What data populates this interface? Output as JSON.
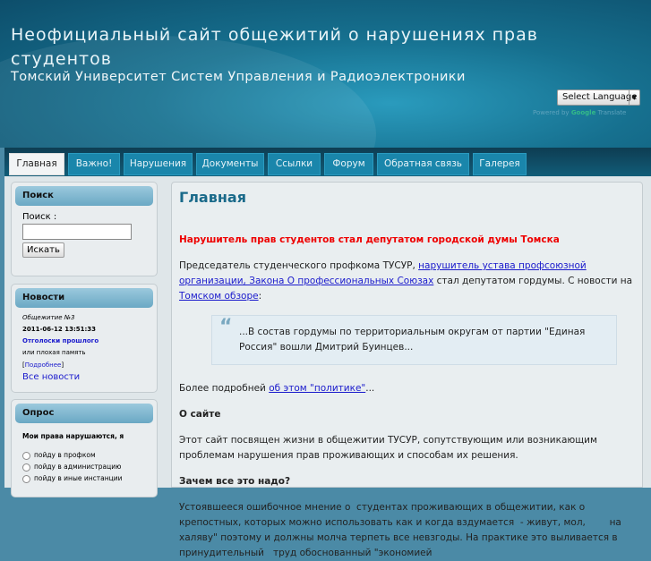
{
  "header": {
    "title": "Неофициальный сайт общежитий о нарушениях прав студентов",
    "subtitle": "Томский Университет Систем Управления и Радиоэлектроники",
    "language_select": "Select Language",
    "powered_by": "Powered by",
    "google": "Google",
    "translate": "Translate"
  },
  "nav": [
    {
      "label": "Главная",
      "active": true
    },
    {
      "label": "Важно!"
    },
    {
      "label": "Нарушения"
    },
    {
      "label": "Документы"
    },
    {
      "label": "Ссылки"
    },
    {
      "label": "Форум"
    },
    {
      "label": "Обратная связь"
    },
    {
      "label": "Галерея"
    }
  ],
  "sidebar": {
    "search": {
      "title": "Поиск",
      "label": "Поиск :",
      "value": "",
      "button": "Искать"
    },
    "news": {
      "title": "Новости",
      "category": "Общежитие №3",
      "date": "2011-06-12 13:51:33",
      "headline": "Отголоски прошлого",
      "teaser": "или плохая память",
      "more_open": "[",
      "more": "Подробнее",
      "more_close": "]",
      "all": "Все новости"
    },
    "poll": {
      "title": "Опрос",
      "question": "Мои права нарушаются, я",
      "options": [
        "пойду в профком",
        "пойду в администрацию",
        "пойду в иные инстанции"
      ]
    }
  },
  "main": {
    "title": "Главная",
    "headline": "Нарушитель прав студентов стал депутатом городской думы Томска",
    "p1_text1": "Председатель студенческого профкома ТУСУР, ",
    "p1_link1": "нарушитель устава профсоюзной организации, Закона О профессиональных Союзах",
    "p1_text2": " стал депутатом гордумы. С новости на ",
    "p1_link2": "Томском обзоре",
    "p1_text3": ":",
    "quote": "...В состав гордумы по территориальным округам от партии \"Единая Россия\" вошли Дмитрий Буинцев...",
    "more_text": "Более подробней ",
    "more_link": "об этом \"политике\"",
    "more_end": "...",
    "about_heading": "О сайте",
    "about_text": "Этот сайт посвящен жизни в общежитии ТУСУР, сопутствующим или возникающим проблемам нарушения прав проживающих и способам их решения.",
    "why_heading": "Зачем все это надо?",
    "why_text": "Устоявшееся ошибочное мнение о  студентах проживающих в общежитии, как о крепостных, которых можно использовать как и когда вздумается  - живут, мол,        на халяву\" поэтому и должны молча терпеть все невзгоды. На практике это выливается в принудительный   труд обоснованный \"экономией"
  }
}
